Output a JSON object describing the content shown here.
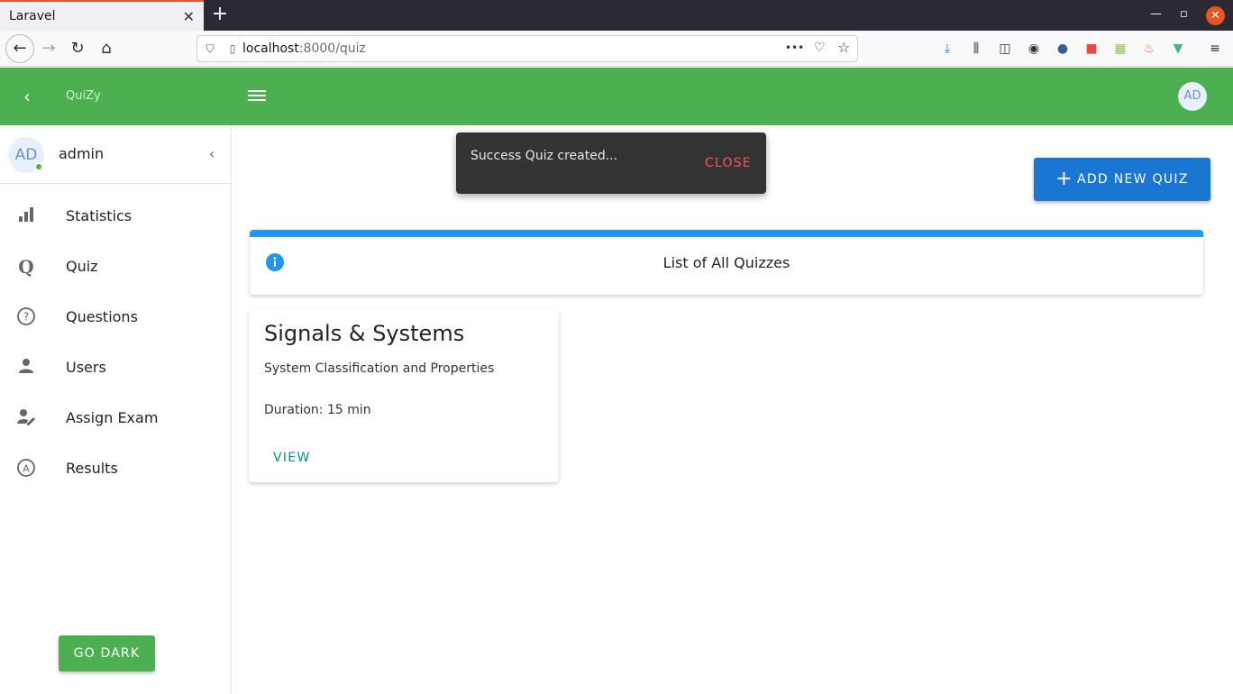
{
  "browser": {
    "tab_title": "Laravel",
    "tab_close": "✕",
    "new_tab": "+",
    "url_host": "localhost",
    "url_path": ":8000/quiz",
    "more": "•••"
  },
  "appbar": {
    "brand": "QuiZy",
    "avatar": "AD"
  },
  "sidebar": {
    "avatar": "AD",
    "username": "admin",
    "items": [
      {
        "label": "Statistics",
        "icon": "bar-chart-icon"
      },
      {
        "label": "Quiz",
        "icon": "quiz-q-icon"
      },
      {
        "label": "Questions",
        "icon": "question-head-icon"
      },
      {
        "label": "Users",
        "icon": "person-icon"
      },
      {
        "label": "Assign Exam",
        "icon": "person-edit-icon"
      },
      {
        "label": "Results",
        "icon": "results-badge-icon"
      }
    ],
    "go_dark": "GO DARK"
  },
  "snackbar": {
    "text": "Success Quiz created...",
    "close": "CLOSE"
  },
  "actions": {
    "add_new_quiz": "ADD NEW QUIZ"
  },
  "alert": {
    "text": "List of All Quizzes",
    "color": "#2196f3"
  },
  "quizzes": [
    {
      "title": "Signals & Systems",
      "subtitle": "System Classification and Properties",
      "duration": "Duration: 15 min",
      "view": "VIEW"
    }
  ],
  "colors": {
    "appbar": "#4caf50",
    "primary_button": "#1976d2",
    "snackbar_close": "#ff5252",
    "view_link": "#009688"
  }
}
